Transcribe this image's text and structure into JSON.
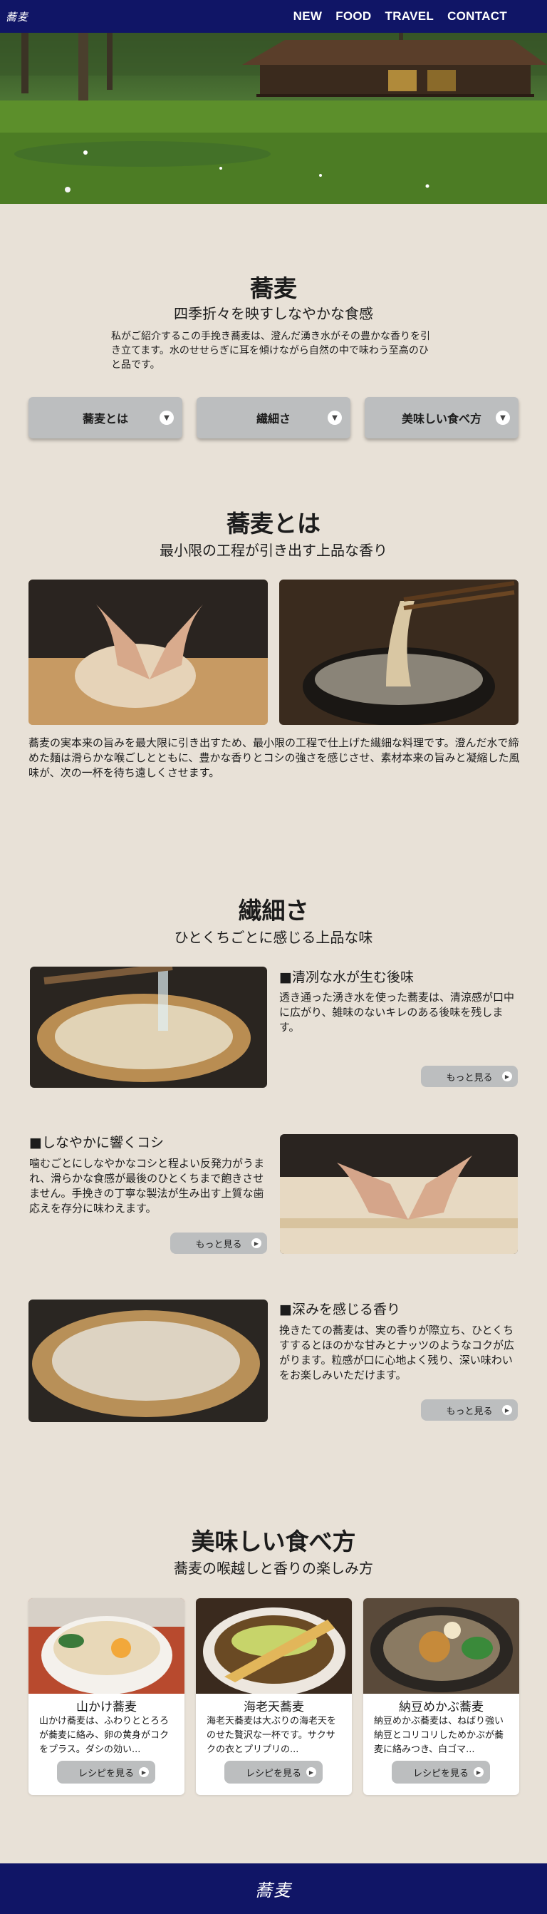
{
  "header": {
    "logo": "蕎麦",
    "nav": [
      "NEW",
      "FOOD",
      "TRAVEL",
      "CONTACT"
    ]
  },
  "intro": {
    "title": "蕎麦",
    "subtitle": "四季折々を映すしなやかな食感",
    "text": "私がご紹介するこの手挽き蕎麦は、澄んだ湧き水がその豊かな香りを引き立てます。水のせせらぎに耳を傾けながら自然の中で味わう至高のひと品です。",
    "accordion": [
      "蕎麦とは",
      "繊細さ",
      "美味しい食べ方"
    ]
  },
  "about": {
    "title": "蕎麦とは",
    "subtitle": "最小限の工程が引き出す上品な香り",
    "text": "蕎麦の実本来の旨みを最大限に引き出すため、最小限の工程で仕上げた繊細な料理です。澄んだ水で締めた麺は滑らかな喉ごしとともに、豊かな香りとコシの強さを感じさせ、素材本来の旨みと凝縮した風味が、次の一杯を待ち遠しくさせます。"
  },
  "delicacy": {
    "title": "繊細さ",
    "subtitle": "ひとくちごとに感じる上品な味",
    "features": [
      {
        "heading": "■清冽な水が生む後味",
        "text": "透き通った湧き水を使った蕎麦は、清涼感が口中に広がり、雑味のないキレのある後味を残します。",
        "button": "もっと見る"
      },
      {
        "heading": "■しなやかに響くコシ",
        "text": "噛むごとにしなやかなコシと程よい反発力がうまれ、滑らかな食感が最後のひとくちまで飽きさせません。手挽きの丁寧な製法が生み出す上質な歯応えを存分に味わえます。",
        "button": "もっと見る"
      },
      {
        "heading": "■深みを感じる香り",
        "text": "挽きたての蕎麦は、実の香りが際立ち、ひとくちすするとほのかな甘みとナッツのようなコクが広がります。粒感が口に心地よく残り、深い味わいをお楽しみいただけます。",
        "button": "もっと見る"
      }
    ]
  },
  "recipes": {
    "title": "美味しい食べ方",
    "subtitle": "蕎麦の喉越しと香りの楽しみ方",
    "cards": [
      {
        "title": "山かけ蕎麦",
        "text": "山かけ蕎麦は、ふわりととろろが蕎麦に絡み、卵の黄身がコクをプラス。ダシの効い...",
        "button": "レシピを見る"
      },
      {
        "title": "海老天蕎麦",
        "text": "海老天蕎麦は大ぶりの海老天をのせた贅沢な一杯です。サクサクの衣とプリプリの...",
        "button": "レシピを見る"
      },
      {
        "title": "納豆めかぶ蕎麦",
        "text": "納豆めかぶ蕎麦は、ねばり強い納豆とコリコリしためかぶが蕎麦に絡みつき、白ゴマ...",
        "button": "レシピを見る"
      }
    ]
  },
  "footer": {
    "logo": "蕎麦"
  }
}
